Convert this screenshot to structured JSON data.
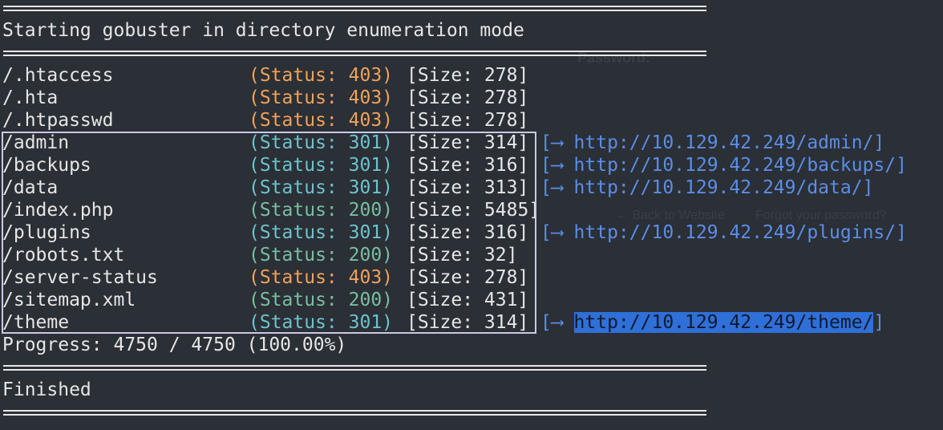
{
  "terminal": {
    "header_text": "Starting gobuster in directory enumeration mode",
    "rows": [
      {
        "path": "/.htaccess",
        "status_text": "(Status: 403)",
        "status_color": "#f0a259",
        "size_text": "[Size: 278]",
        "redirect_arrow": "",
        "redirect_url": ""
      },
      {
        "path": "/.hta",
        "status_text": "(Status: 403)",
        "status_color": "#f0a259",
        "size_text": "[Size: 278]",
        "redirect_arrow": "",
        "redirect_url": ""
      },
      {
        "path": "/.htpasswd",
        "status_text": "(Status: 403)",
        "status_color": "#f0a259",
        "size_text": "[Size: 278]",
        "redirect_arrow": "",
        "redirect_url": ""
      },
      {
        "path": "/admin",
        "status_text": "(Status: 301)",
        "status_color": "#6cc3cc",
        "size_text": "[Size: 314]",
        "redirect_arrow": "[-->",
        "redirect_url": "http://10.129.42.249/admin/]"
      },
      {
        "path": "/backups",
        "status_text": "(Status: 301)",
        "status_color": "#6cc3cc",
        "size_text": "[Size: 316]",
        "redirect_arrow": "[-->",
        "redirect_url": "http://10.129.42.249/backups/]"
      },
      {
        "path": "/data",
        "status_text": "(Status: 301)",
        "status_color": "#6cc3cc",
        "size_text": "[Size: 313]",
        "redirect_arrow": "[-->",
        "redirect_url": "http://10.129.42.249/data/]"
      },
      {
        "path": "/index.php",
        "status_text": "(Status: 200)",
        "status_color": "#78bfa2",
        "size_text": "[Size: 5485]",
        "redirect_arrow": "",
        "redirect_url": ""
      },
      {
        "path": "/plugins",
        "status_text": "(Status: 301)",
        "status_color": "#6cc3cc",
        "size_text": "[Size: 316]",
        "redirect_arrow": "[-->",
        "redirect_url": "http://10.129.42.249/plugins/]"
      },
      {
        "path": "/robots.txt",
        "status_text": "(Status: 200)",
        "status_color": "#78bfa2",
        "size_text": "[Size: 32]",
        "redirect_arrow": "",
        "redirect_url": ""
      },
      {
        "path": "/server-status",
        "status_text": "(Status: 403)",
        "status_color": "#f0a259",
        "size_text": "[Size: 278]",
        "redirect_arrow": "",
        "redirect_url": ""
      },
      {
        "path": "/sitemap.xml",
        "status_text": "(Status: 200)",
        "status_color": "#78bfa2",
        "size_text": "[Size: 431]",
        "redirect_arrow": "",
        "redirect_url": ""
      },
      {
        "path": "/theme",
        "status_text": "(Status: 301)",
        "status_color": "#6cc3cc",
        "size_text": "[Size: 314]",
        "redirect_arrow": "[-->",
        "redirect_url": "http://10.129.42.249/theme/]",
        "selected_url": "http://10.129.42.249/theme/",
        "selected_suffix": "]"
      }
    ],
    "progress_text": "Progress: 4750 / 4750 (100.00%)",
    "finished_text": "Finished"
  },
  "background_page": {
    "password_label": "Password:",
    "back_link": "← Back to Website",
    "forgot_link": "Forgot your password?"
  },
  "colors": {
    "background": "#2b2f36",
    "text": "#e6e6e6",
    "status_403": "#f0a259",
    "status_301": "#6cc3cc",
    "status_200": "#78bfa2",
    "link": "#5b8ee6",
    "selection": "#2f6fd8",
    "highlight_box": "#c9c9e6"
  }
}
